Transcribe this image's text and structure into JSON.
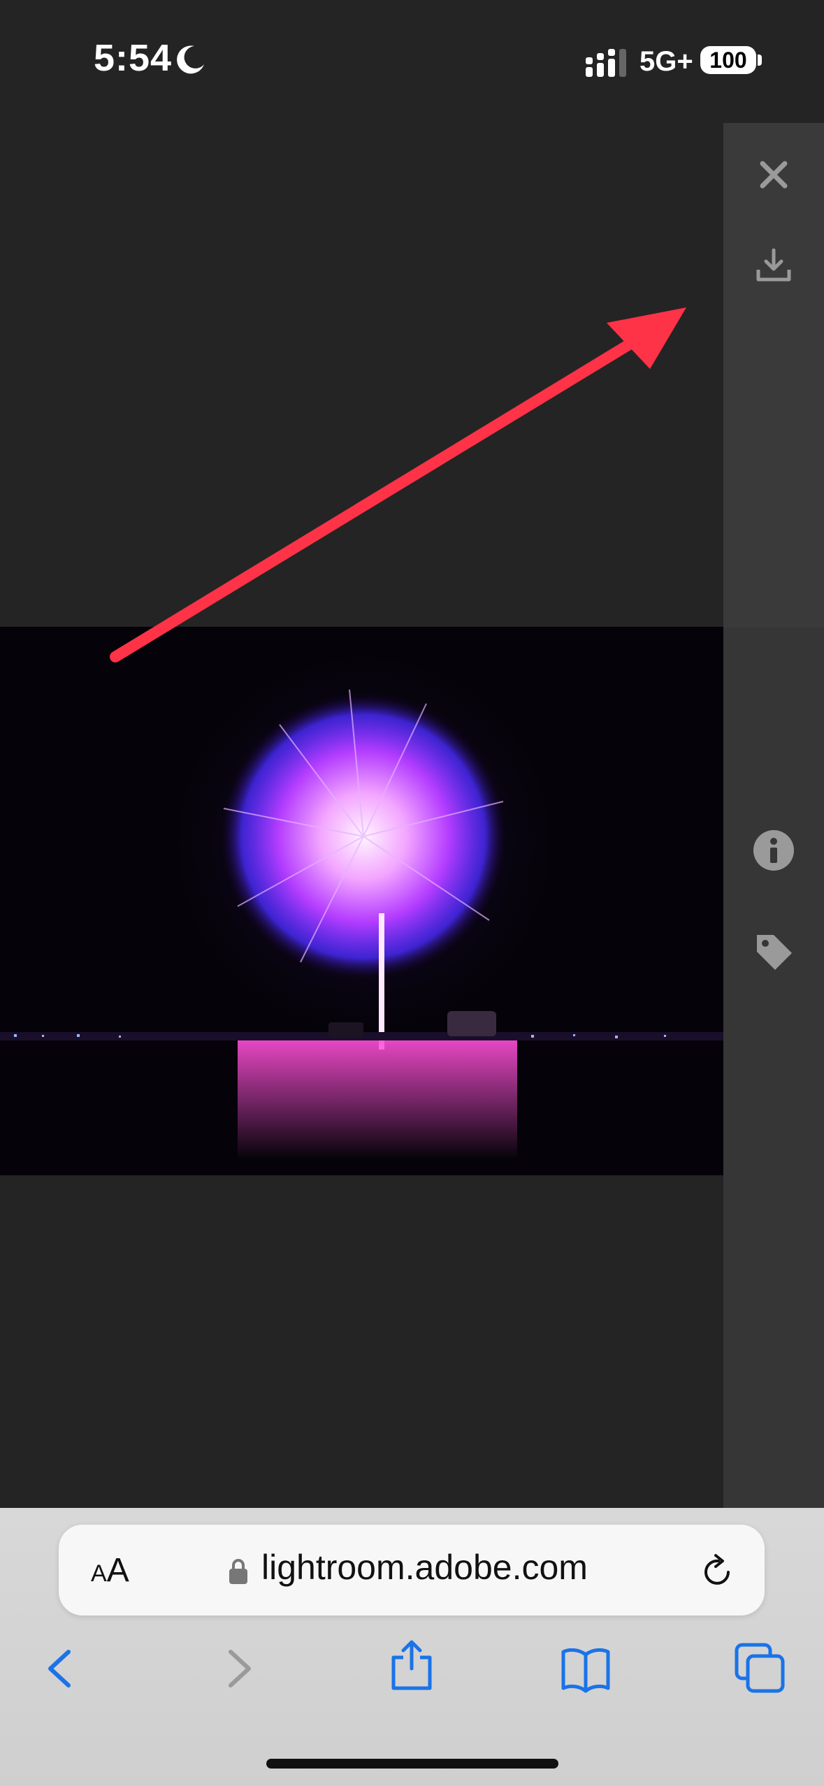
{
  "status_bar": {
    "time": "5:54",
    "network": "5G+",
    "battery": "100"
  },
  "side_panel": {
    "icons": [
      "close-icon",
      "download-icon",
      "info-icon",
      "tag-icon"
    ]
  },
  "photo": {
    "subject": "fireworks"
  },
  "annotation": {
    "color": "#ff3347"
  },
  "browser": {
    "text_size_label_small": "A",
    "text_size_label_large": "A",
    "url": "lightroom.adobe.com",
    "toolbar": [
      "back-icon",
      "forward-icon",
      "share-icon",
      "bookmarks-icon",
      "tabs-icon"
    ]
  },
  "colors": {
    "accent": "#1a73e8",
    "panel": "#363636",
    "background": "#242424"
  }
}
